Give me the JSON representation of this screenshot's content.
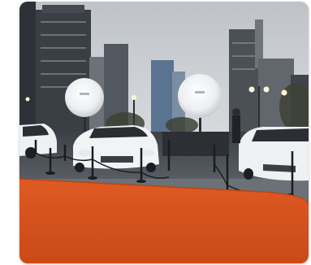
{
  "image": {
    "description_tags": [
      "city-skyline",
      "sports-cars",
      "light-balloons",
      "red-carpet",
      "stanchions"
    ],
    "colors": {
      "sky": "#c9ccd0",
      "carpet": "#d9531f",
      "car_white": "#eef0f2",
      "pavement": "#4a4f55",
      "balloon": "#f2f3f5"
    }
  }
}
